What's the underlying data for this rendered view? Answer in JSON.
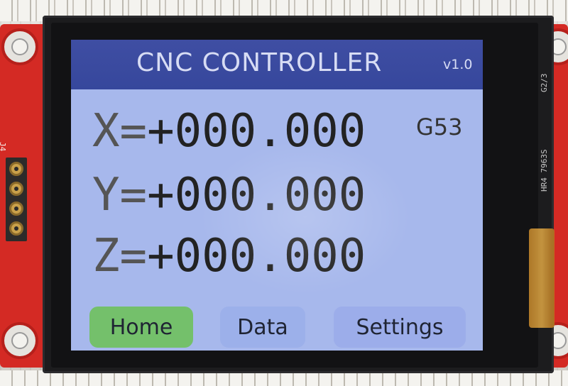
{
  "header": {
    "title": "CNC CONTROLLER",
    "version": "v1.0"
  },
  "coordinates": {
    "x": {
      "axis": "X=",
      "value": "+000.000"
    },
    "y": {
      "axis": "Y=",
      "value": "+000.000"
    },
    "z": {
      "axis": "Z=",
      "value": "+000.000"
    },
    "wcs": "G53"
  },
  "nav": {
    "home": "Home",
    "data": "Data",
    "settings": "Settings",
    "active": "home"
  },
  "pcb": {
    "header_label": "J4",
    "bezel_label_top": "G2/3",
    "bezel_label_side": "HR4 7963S"
  },
  "colors": {
    "header_bg": "#3f4ea3",
    "screen_bg": "#a7b8ec",
    "active_tab": "#74c06b",
    "pcb": "#d42a24"
  }
}
